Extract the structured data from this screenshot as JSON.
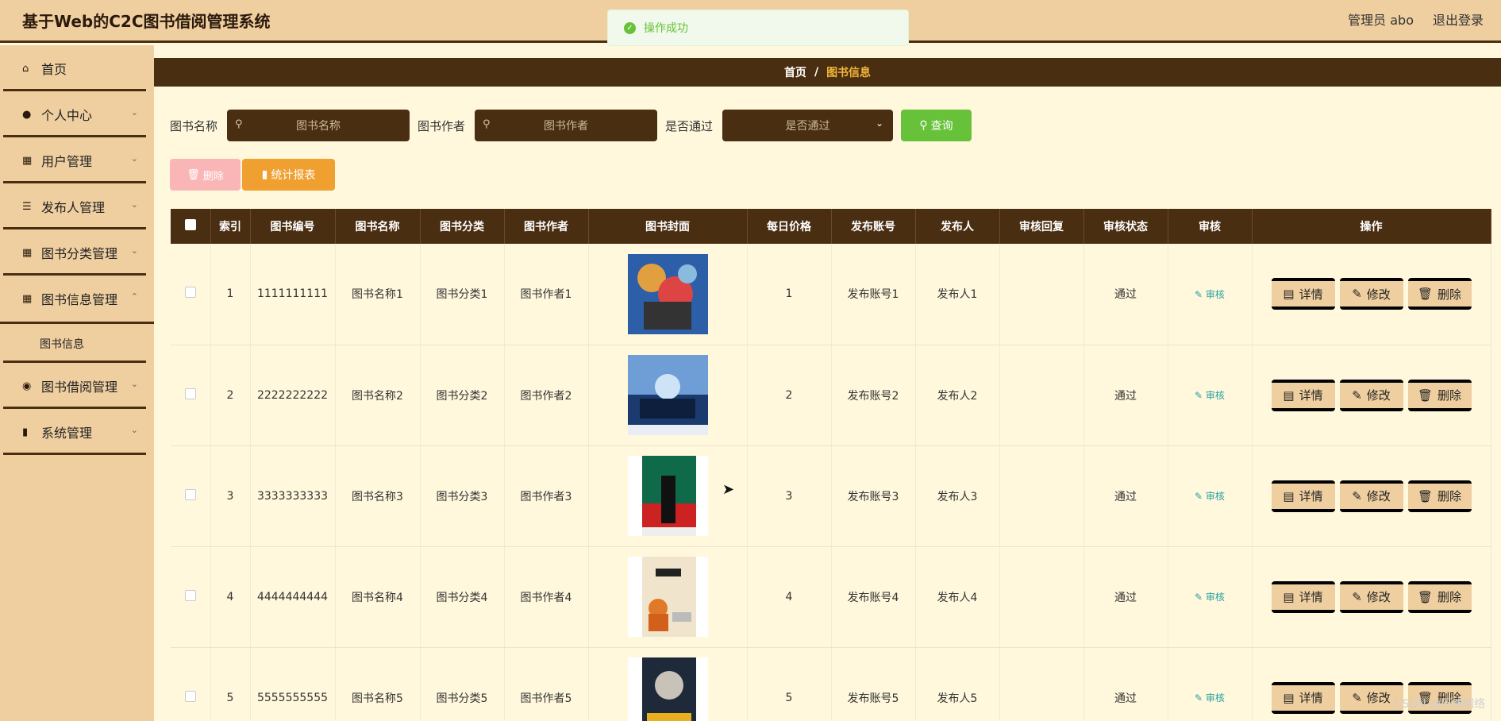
{
  "app": {
    "title": "基于Web的C2C图书借阅管理系统"
  },
  "topright": {
    "user": "管理员 abo",
    "logout": "退出登录"
  },
  "toast": {
    "message": "操作成功"
  },
  "sidebar": {
    "items": [
      {
        "label": "首页",
        "icon": "home-icon"
      },
      {
        "label": "个人中心",
        "icon": "user-icon"
      },
      {
        "label": "用户管理",
        "icon": "grid-icon"
      },
      {
        "label": "发布人管理",
        "icon": "list-icon"
      },
      {
        "label": "图书分类管理",
        "icon": "grid-icon"
      },
      {
        "label": "图书信息管理",
        "icon": "grid-icon"
      },
      {
        "label": "图书信息",
        "icon": ""
      },
      {
        "label": "图书借阅管理",
        "icon": "location-icon"
      },
      {
        "label": "系统管理",
        "icon": "bar-chart-icon"
      }
    ]
  },
  "breadcrumb": {
    "home": "首页",
    "sep": "/",
    "current": "图书信息"
  },
  "search": {
    "name_label": "图书名称",
    "name_placeholder": "图书名称",
    "author_label": "图书作者",
    "author_placeholder": "图书作者",
    "pass_label": "是否通过",
    "pass_placeholder": "是否通过",
    "query": "查询"
  },
  "actions": {
    "delete": "删除",
    "stats": "统计报表"
  },
  "table": {
    "headers": [
      "索引",
      "图书编号",
      "图书名称",
      "图书分类",
      "图书作者",
      "图书封面",
      "每日价格",
      "发布账号",
      "发布人",
      "审核回复",
      "审核状态",
      "审核",
      "操作"
    ],
    "rows": [
      {
        "index": "1",
        "code": "1111111111",
        "name": "图书名称1",
        "category": "图书分类1",
        "author": "图书作者1",
        "price": "1",
        "account": "发布账号1",
        "publisher": "发布人1",
        "reply": "",
        "status": "通过"
      },
      {
        "index": "2",
        "code": "2222222222",
        "name": "图书名称2",
        "category": "图书分类2",
        "author": "图书作者2",
        "price": "2",
        "account": "发布账号2",
        "publisher": "发布人2",
        "reply": "",
        "status": "通过"
      },
      {
        "index": "3",
        "code": "3333333333",
        "name": "图书名称3",
        "category": "图书分类3",
        "author": "图书作者3",
        "price": "3",
        "account": "发布账号3",
        "publisher": "发布人3",
        "reply": "",
        "status": "通过"
      },
      {
        "index": "4",
        "code": "4444444444",
        "name": "图书名称4",
        "category": "图书分类4",
        "author": "图书作者4",
        "price": "4",
        "account": "发布账号4",
        "publisher": "发布人4",
        "reply": "",
        "status": "通过"
      },
      {
        "index": "5",
        "code": "5555555555",
        "name": "图书名称5",
        "category": "图书分类5",
        "author": "图书作者5",
        "price": "5",
        "account": "发布账号5",
        "publisher": "发布人5",
        "reply": "",
        "status": "通过"
      }
    ],
    "audit_label": "审核",
    "btn_detail": "详情",
    "btn_edit": "修改",
    "btn_delete": "删除"
  },
  "watermark": "CSDN @历博网络",
  "colors": {
    "brown": "#4a2e12",
    "tan": "#efcfa0",
    "cream": "#fff8dc",
    "green": "#67c23a",
    "orange": "#f0a030",
    "pink": "#fab6b6"
  }
}
